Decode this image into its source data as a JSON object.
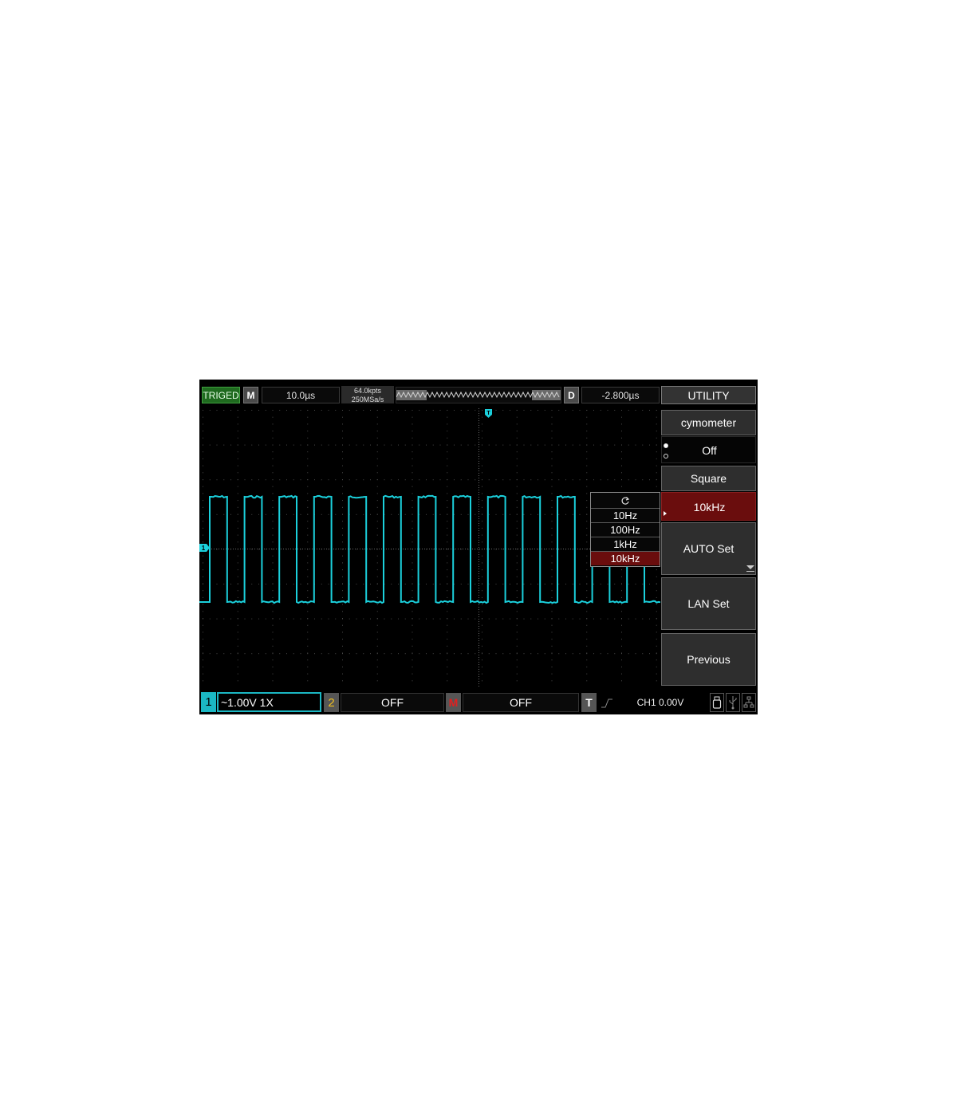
{
  "top_bar": {
    "trigger_status": "TRIGED",
    "mode": "M",
    "timebase": "10.0µs",
    "memory_depth": "64.0kpts",
    "sample_rate": "250MSa/s",
    "delay_label": "D",
    "trigger_delay": "-2.800µs",
    "menu_title": "UTILITY"
  },
  "waveform": {
    "channel_marker": "1",
    "trigger_marker": "T",
    "trace_color": "#1bd0dc"
  },
  "menu": {
    "cymometer_label": "cymometer",
    "cymometer_value": "Off",
    "wave_type": "Square",
    "frequency": "10kHz",
    "auto_set": "AUTO Set",
    "lan_set": "LAN Set",
    "previous": "Previous"
  },
  "dropdown": {
    "options": [
      "10Hz",
      "100Hz",
      "1kHz",
      "10kHz"
    ],
    "selected": "10kHz"
  },
  "bottom_bar": {
    "ch1_number": "1",
    "ch1_info": "~1.00V 1X",
    "ch2_number": "2",
    "ch2_value": "OFF",
    "math_label": "M",
    "math_value": "OFF",
    "trigger_label": "T",
    "trigger_value": "CH1 0.00V"
  },
  "colors": {
    "channel1": "#1bb8c4",
    "channel2": "#f0c020",
    "math": "#e02020",
    "selected": "#6a0d0d",
    "triggered": "#1f6a1f"
  },
  "icons": {
    "refresh": "refresh-icon",
    "usb_disk": "usb-disk-icon",
    "usb": "usb-icon",
    "lan": "lan-icon",
    "trigger_edge": "rising-edge-icon"
  }
}
